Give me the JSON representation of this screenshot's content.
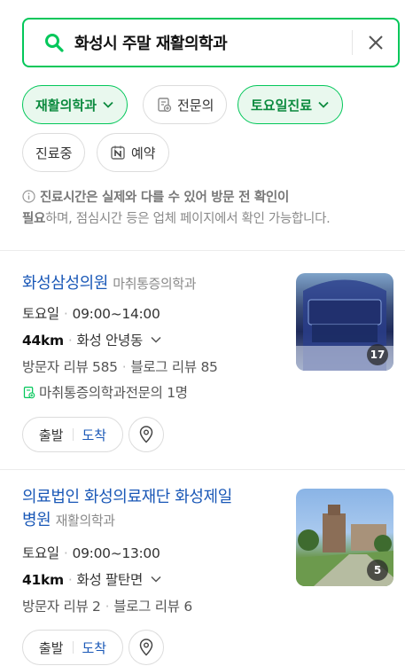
{
  "search": {
    "query": "화성시 주말 재활의학과"
  },
  "filters": {
    "row1": [
      {
        "label": "재활의학과",
        "active": true,
        "dropdown": true
      },
      {
        "label": "전문의",
        "active": false,
        "icon": "doctor-badge-icon"
      },
      {
        "label": "토요일진료",
        "active": true,
        "dropdown": true
      }
    ],
    "row2": [
      {
        "label": "진료중",
        "active": false
      },
      {
        "label": "예약",
        "active": false,
        "icon": "naver-booking-icon"
      }
    ]
  },
  "notice": {
    "bold1": "진료시간은 실제와 다를 수 있어 방문 전 확인이",
    "bold2": "필요",
    "rest": "하며, 점심시간 등은 업체 페이지에서 확인 가능합니다."
  },
  "results": [
    {
      "name": "화성삼성의원",
      "category": "마취통증의학과",
      "day": "토요일",
      "hours": "09:00~14:00",
      "distance": "44km",
      "area": "화성 안녕동",
      "visitor_review_label": "방문자 리뷰 585",
      "blog_review_label": "블로그 리뷰 85",
      "specialist_text": "마취통증의학과전문의 1명",
      "photo_count": "17",
      "depart_label": "출발",
      "arrive_label": "도착"
    },
    {
      "name_line1": "의료법인 화성의료재단 화성제일",
      "name_line2": "병원",
      "category": "재활의학과",
      "day": "토요일",
      "hours": "09:00~13:00",
      "distance": "41km",
      "area": "화성 팔탄면",
      "visitor_review_label": "방문자 리뷰 2",
      "blog_review_label": "블로그 리뷰 6",
      "photo_count": "5",
      "depart_label": "출발",
      "arrive_label": "도착"
    }
  ],
  "colors": {
    "accent": "#03c75a",
    "link": "#1a58b7"
  }
}
